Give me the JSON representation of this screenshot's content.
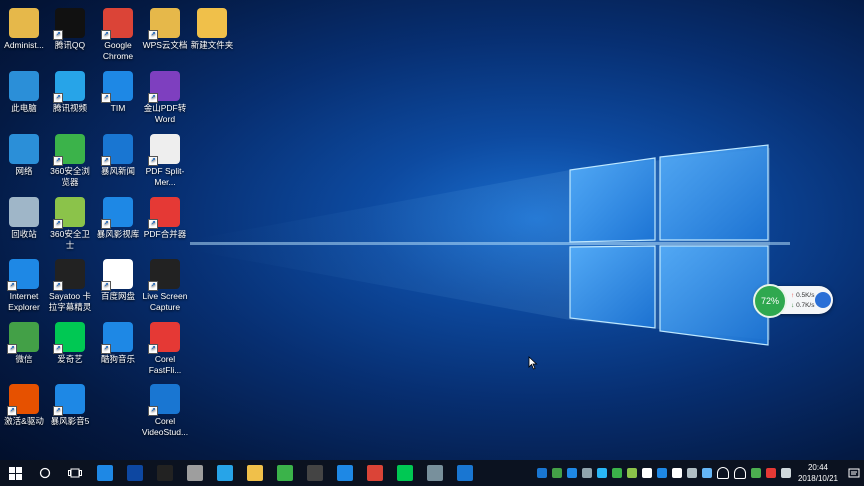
{
  "desktop_icons": [
    {
      "label": "Administ...",
      "icon": "user-folder-icon",
      "color": "#e6b84a"
    },
    {
      "label": "腾讯QQ",
      "icon": "qq-icon",
      "color": "#111111"
    },
    {
      "label": "Google Chrome",
      "icon": "chrome-icon",
      "color": "#db4437"
    },
    {
      "label": "WPS云文档",
      "icon": "wps-cloud-icon",
      "color": "#e6b84a"
    },
    {
      "label": "新建文件夹",
      "icon": "folder-icon",
      "color": "#f0c04a"
    },
    {
      "label": "此电脑",
      "icon": "computer-icon",
      "color": "#2b8fd8"
    },
    {
      "label": "腾讯视频",
      "icon": "tencent-video-icon",
      "color": "#27a4e8"
    },
    {
      "label": "TIM",
      "icon": "tim-icon",
      "color": "#1e88e5"
    },
    {
      "label": "金山PDF转Word",
      "icon": "pdf-to-word-icon",
      "color": "#7e3fbf"
    },
    {
      "label": "网络",
      "icon": "network-icon",
      "color": "#2b8fd8"
    },
    {
      "label": "360安全浏览器",
      "icon": "360-browser-icon",
      "color": "#3bb34a"
    },
    {
      "label": "暴风新闻",
      "icon": "storm-news-icon",
      "color": "#1976d2"
    },
    {
      "label": "PDF Split-Mer...",
      "icon": "pdf-split-icon",
      "color": "#eeeeee"
    },
    {
      "label": "回收站",
      "icon": "recycle-bin-icon",
      "color": "#9fb6c8"
    },
    {
      "label": "360安全卫士",
      "icon": "360-safe-icon",
      "color": "#8bc34a"
    },
    {
      "label": "暴风影视库",
      "icon": "storm-library-icon",
      "color": "#1e88e5"
    },
    {
      "label": "PDF合并器",
      "icon": "pdf-merge-icon",
      "color": "#e53935"
    },
    {
      "label": "Internet Explorer",
      "icon": "ie-icon",
      "color": "#1e88e5"
    },
    {
      "label": "Sayatoo 卡拉字幕精灵",
      "icon": "sayatoo-icon",
      "color": "#222222"
    },
    {
      "label": "百度网盘",
      "icon": "baidu-netdisk-icon",
      "color": "#ffffff"
    },
    {
      "label": "Live Screen Capture",
      "icon": "screen-capture-icon",
      "color": "#222222"
    },
    {
      "label": "微信",
      "icon": "wechat-icon",
      "color": "#43a047"
    },
    {
      "label": "爱奇艺",
      "icon": "iqiyi-icon",
      "color": "#00c853"
    },
    {
      "label": "酷狗音乐",
      "icon": "kugou-icon",
      "color": "#1e88e5"
    },
    {
      "label": "Corel FastFli...",
      "icon": "corel-fastflick-icon",
      "color": "#e53935"
    },
    {
      "label": "激活&驱动",
      "icon": "activate-driver-icon",
      "color": "#e65100"
    },
    {
      "label": "暴风影音5",
      "icon": "storm-player-icon",
      "color": "#1e88e5"
    },
    {
      "label": "Corel VideoStud...",
      "icon": "corel-videostudio-icon",
      "color": "#1976d2"
    }
  ],
  "net_widget": {
    "percent": "72%",
    "upload": "0.5K/s",
    "download": "0.7K/s"
  },
  "taskbar": {
    "items": [
      {
        "icon": "start-icon"
      },
      {
        "icon": "search-circle-icon"
      },
      {
        "icon": "task-view-icon"
      },
      {
        "icon": "ie-icon"
      },
      {
        "icon": "photoshop-icon"
      },
      {
        "icon": "screen-capture-icon"
      },
      {
        "icon": "disk-icon"
      },
      {
        "icon": "tencent-video-icon"
      },
      {
        "icon": "folder-icon"
      },
      {
        "icon": "360-browser-icon"
      },
      {
        "icon": "sayatoo-icon"
      },
      {
        "icon": "kugou-icon"
      },
      {
        "icon": "chrome-icon"
      },
      {
        "icon": "iqiyi-icon"
      },
      {
        "icon": "network-tool-icon"
      },
      {
        "icon": "storm-news-icon"
      }
    ],
    "time": "20:44",
    "date": "2018/10/21"
  },
  "colors": {
    "taskbar": "#0b1220",
    "wallpaper": "#0d4aa0",
    "accent": "#2fa84f"
  }
}
